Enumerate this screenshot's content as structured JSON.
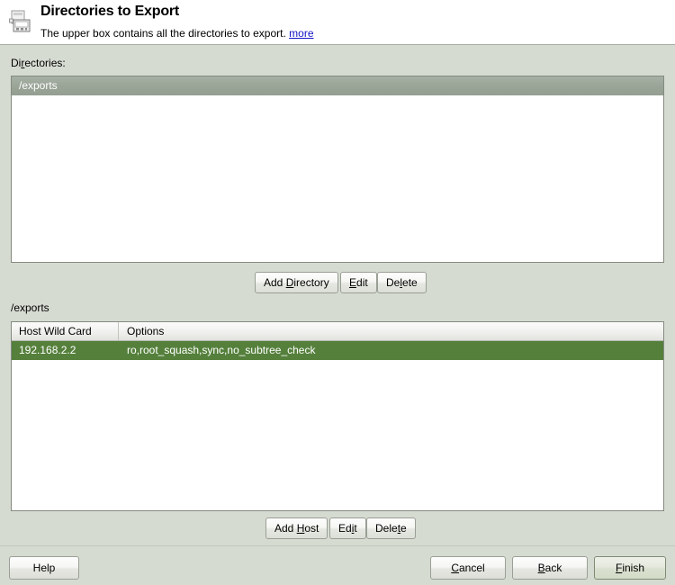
{
  "window": {
    "title": "Directories to Export",
    "subtitle": "The upper box contains all the directories to export.",
    "more_link": "more",
    "icon": "nfs-server-icon"
  },
  "directories_section": {
    "label_pre": "Di",
    "label_mnemonic": "r",
    "label_post": "ectories:",
    "items": [
      {
        "path": "/exports",
        "selected": true
      }
    ]
  },
  "directory_buttons": {
    "add": {
      "pre": "Add ",
      "mnemonic": "D",
      "post": "irectory"
    },
    "edit": {
      "pre": "",
      "mnemonic": "E",
      "post": "dit"
    },
    "delete": {
      "pre": "De",
      "mnemonic": "l",
      "post": "ete"
    }
  },
  "hosts_section": {
    "label": "/exports",
    "columns": [
      "Host Wild Card",
      "Options"
    ],
    "rows": [
      {
        "host": "192.168.2.2",
        "options": "ro,root_squash,sync,no_subtree_check",
        "selected": true
      }
    ],
    "selection_color": "#55803c"
  },
  "host_buttons": {
    "add": {
      "pre": "Add ",
      "mnemonic": "H",
      "post": "ost"
    },
    "edit": {
      "pre": "Ed",
      "mnemonic": "i",
      "post": "t"
    },
    "delete": {
      "pre": "Dele",
      "mnemonic": "t",
      "post": "e"
    }
  },
  "footer": {
    "help": {
      "pre": "Help",
      "mnemonic": "",
      "post": ""
    },
    "cancel": {
      "pre": "",
      "mnemonic": "C",
      "post": "ancel"
    },
    "back": {
      "pre": "",
      "mnemonic": "B",
      "post": "ack"
    },
    "finish": {
      "pre": "",
      "mnemonic": "F",
      "post": "inish"
    }
  }
}
